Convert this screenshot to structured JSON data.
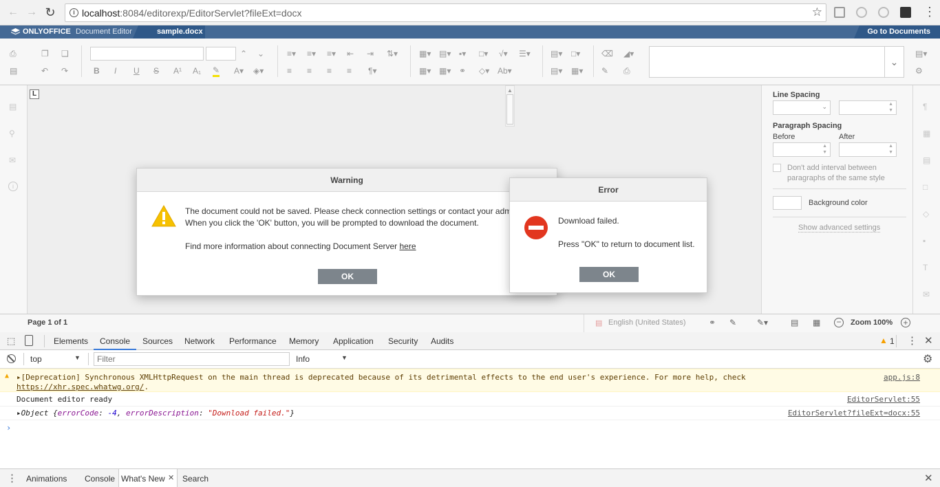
{
  "browser": {
    "url_host": "localhost",
    "url_rest": ":8084/editorexp/EditorServlet?fileExt=docx",
    "back_icon": "arrow-left",
    "forward_icon": "arrow-right",
    "reload_icon": "reload",
    "info_icon": "info",
    "bookmark_icon": "star"
  },
  "oo_header": {
    "logo": "ONLYOFFICE",
    "product": "Document Editor",
    "doc_name": "sample.docx",
    "go_to_documents": "Go to Documents"
  },
  "right_panel": {
    "line_spacing": "Line Spacing",
    "paragraph_spacing": "Paragraph Spacing",
    "before": "Before",
    "after": "After",
    "dont_add_interval": "Don't add interval between",
    "dont_add_interval_2": "paragraphs of the same style",
    "background_color": "Background color",
    "show_advanced": "Show advanced settings"
  },
  "statusbar": {
    "page_info": "Page 1 of 1",
    "language": "English (United States)",
    "zoom": "Zoom 100%"
  },
  "warning_dialog": {
    "title": "Warning",
    "line1": "The document could not be saved. Please check connection settings or contact your adm",
    "line2": "When you click the 'OK' button, you will be prompted to download the document.",
    "line3_prefix": "Find more information about connecting Document Server ",
    "line3_link": "here",
    "ok": "OK"
  },
  "error_dialog": {
    "title": "Error",
    "line1": "Download failed.",
    "line2": "Press \"OK\" to return to document list.",
    "ok": "OK"
  },
  "devtools": {
    "tabs": [
      "Elements",
      "Console",
      "Sources",
      "Network",
      "Performance",
      "Memory",
      "Application",
      "Security",
      "Audits"
    ],
    "active_tab": "Console",
    "warning_count": "1",
    "context": "top",
    "filter_placeholder": "Filter",
    "level": "Info",
    "messages": {
      "warn_text": "[Deprecation] Synchronous XMLHttpRequest on the main thread is deprecated because of its detrimental effects to the end user's experience. For more help, check",
      "warn_link": "https://xhr.spec.whatwg.org/",
      "warn_src": "app.js:8",
      "log1": "Document editor ready",
      "log1_src": "EditorServlet:55",
      "obj_prefix": "Object {",
      "obj_key1": "errorCode",
      "obj_val1": "-4",
      "obj_key2": "errorDescription",
      "obj_val2": "\"Download failed.\"",
      "obj_suffix": "}",
      "obj_src": "EditorServlet?fileExt=docx:55"
    },
    "drawer_tabs": [
      "Animations",
      "Console",
      "What's New",
      "Search"
    ]
  },
  "colors": {
    "oo_blue": "#446995",
    "oo_dark_blue": "#2f5888",
    "ok_gray": "#7d858c",
    "error_red": "#e2361f",
    "warning_yellow": "#f6c100"
  }
}
